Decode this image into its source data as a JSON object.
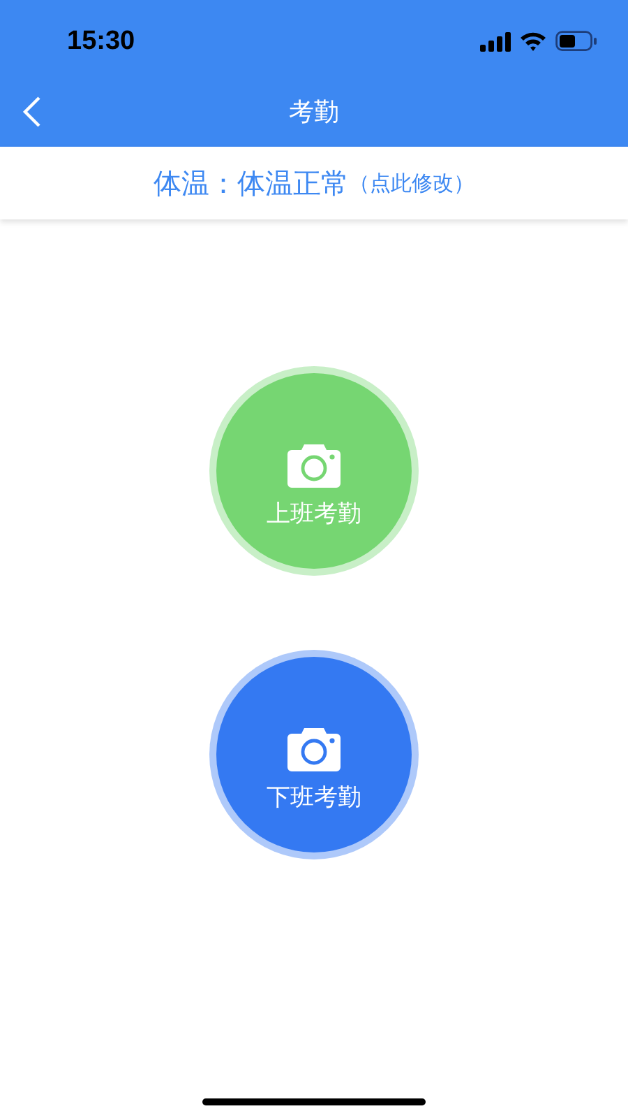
{
  "status_bar": {
    "time": "15:30"
  },
  "nav_bar": {
    "title": "考勤"
  },
  "temperature": {
    "label": "体温：体温正常",
    "action": "（点此修改）"
  },
  "buttons": [
    {
      "label": "上班考勤",
      "color": "#76d672"
    },
    {
      "label": "下班考勤",
      "color": "#3479f2"
    }
  ]
}
